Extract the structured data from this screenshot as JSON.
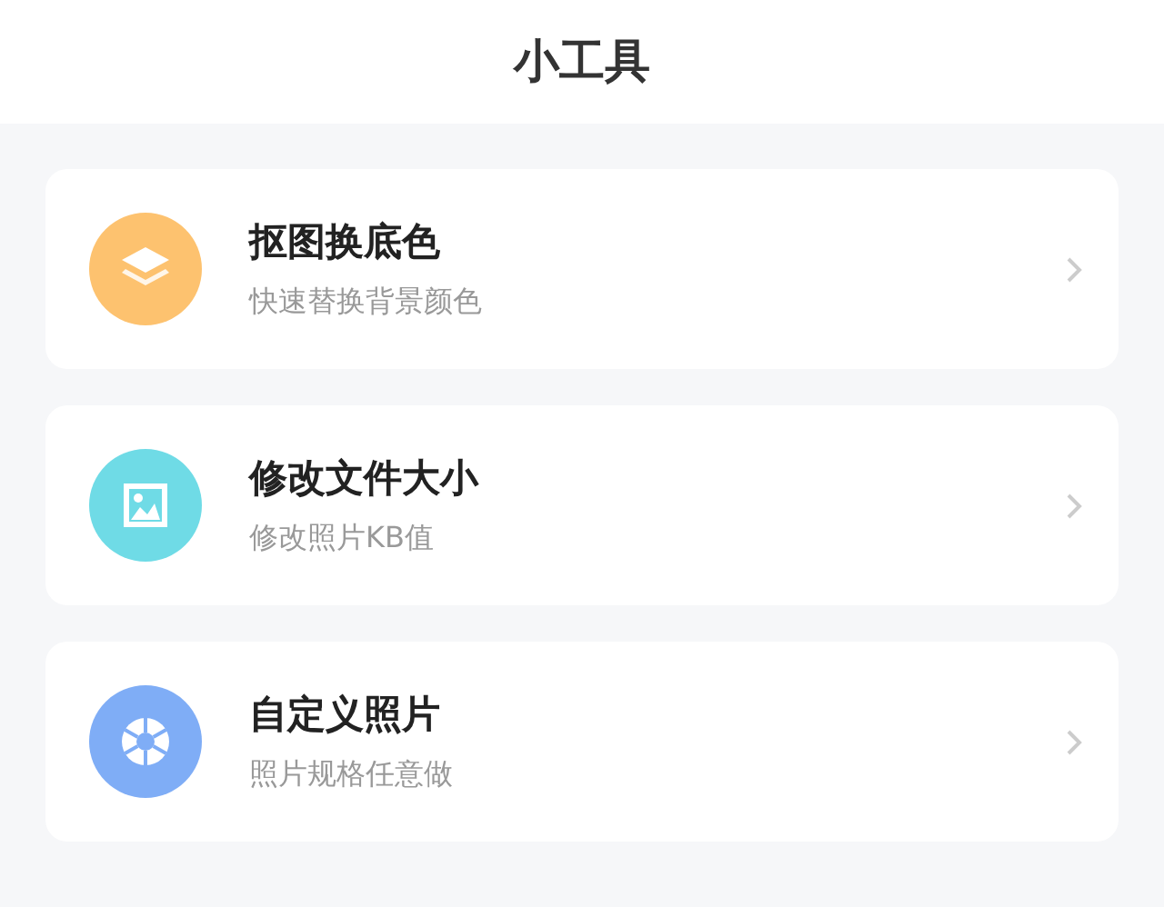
{
  "header": {
    "title": "小工具"
  },
  "tools": [
    {
      "kind": "layers",
      "color": "#fdc26f",
      "title": "抠图换底色",
      "subtitle": "快速替换背景颜色"
    },
    {
      "kind": "image",
      "color": "#6fdbe6",
      "title": "修改文件大小",
      "subtitle": "修改照片KB值"
    },
    {
      "kind": "aperture",
      "color": "#7fadf6",
      "title": "自定义照片",
      "subtitle": "照片规格任意做"
    }
  ]
}
